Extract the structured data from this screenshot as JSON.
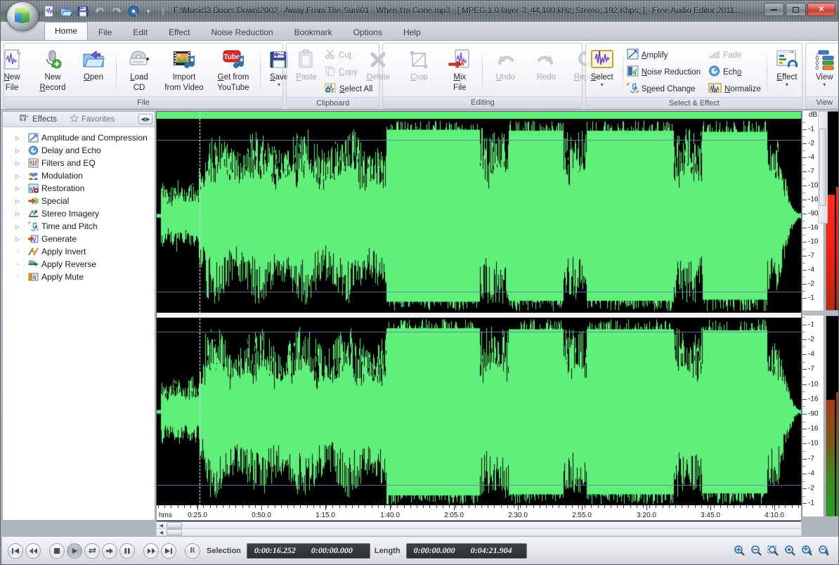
{
  "window": {
    "title": "F:\\Music\\3 Doors Down\\2002 - Away From The Sun\\01 - When I'm Gone.mp3 - [ MPEG 1.0 layer-3: 44,100 kHz; Stereo; 192 Kbps;  ] - Free Audio Editor 2011...",
    "minimize": "–",
    "maximize": "□",
    "close": "✕"
  },
  "quick_access": [
    {
      "name": "new-file",
      "icon": "new-file-icon"
    },
    {
      "name": "open",
      "icon": "open-folder-icon"
    },
    {
      "name": "save",
      "icon": "save-disk-icon"
    },
    {
      "name": "undo",
      "icon": "undo-icon"
    },
    {
      "name": "redo",
      "icon": "redo-icon"
    },
    {
      "name": "burn-cd",
      "icon": "burn-cd-icon"
    },
    {
      "name": "customize",
      "icon": "chevron-down-icon"
    }
  ],
  "tabs": [
    {
      "label": "Home",
      "active": true
    },
    {
      "label": "File",
      "active": false
    },
    {
      "label": "Edit",
      "active": false
    },
    {
      "label": "Effect",
      "active": false
    },
    {
      "label": "Noise Reduction",
      "active": false
    },
    {
      "label": "Bookmark",
      "active": false
    },
    {
      "label": "Options",
      "active": false
    },
    {
      "label": "Help",
      "active": false
    }
  ],
  "ribbon": {
    "file_group": {
      "title": "File",
      "buttons": [
        {
          "line1": "New",
          "line2": "File",
          "icon": "new-file-icon"
        },
        {
          "line1": "New",
          "line2": "Record",
          "icon": "microphone-record-icon"
        },
        {
          "line1": "Open",
          "line2": "",
          "icon": "open-folder-icon"
        },
        {
          "line1": "Load",
          "line2": "CD",
          "icon": "cd-drive-icon"
        },
        {
          "line1": "Import",
          "line2": "from Video",
          "icon": "film-music-icon"
        },
        {
          "line1": "Get from",
          "line2": "YouTube",
          "icon": "youtube-icon"
        },
        {
          "line1": "Save",
          "line2": "",
          "icon": "save-disk-icon",
          "dropdown": true
        }
      ]
    },
    "clipboard_group": {
      "title": "Clipboard",
      "paste": {
        "label": "Paste",
        "icon": "paste-icon",
        "disabled": true
      },
      "items": [
        {
          "label": "Cut",
          "icon": "scissors-icon",
          "disabled": true
        },
        {
          "label": "Copy",
          "icon": "copy-icon",
          "disabled": true
        },
        {
          "label": "Select All",
          "icon": "select-all-icon",
          "disabled": false
        }
      ]
    },
    "editing_group": {
      "title": "Editing",
      "buttons": [
        {
          "line1": "Delete",
          "line2": "",
          "icon": "delete-x-icon",
          "disabled": true
        },
        {
          "line1": "Crop",
          "line2": "",
          "icon": "crop-icon",
          "disabled": true
        },
        {
          "line1": "Mix",
          "line2": "File",
          "icon": "mix-file-icon",
          "disabled": false
        },
        {
          "line1": "Undo",
          "line2": "",
          "icon": "undo-icon",
          "disabled": true
        },
        {
          "line1": "Redo",
          "line2": "",
          "icon": "redo-icon",
          "disabled": true
        },
        {
          "line1": "Repeat",
          "line2": "",
          "icon": "repeat-icon",
          "disabled": true
        }
      ]
    },
    "select_effect_group": {
      "title": "Select & Effect",
      "select": {
        "label": "Select",
        "icon": "select-wave-icon",
        "dropdown": true
      },
      "items": [
        {
          "label": "Amplify",
          "icon": "amplify-icon",
          "disabled": false
        },
        {
          "label": "Fade",
          "icon": "fade-icon",
          "disabled": true
        },
        {
          "label": "Noise Reduction",
          "icon": "noise-reduction-icon",
          "disabled": false
        },
        {
          "label": "Echo",
          "icon": "echo-icon",
          "disabled": false
        },
        {
          "label": "Speed Change",
          "icon": "speed-change-icon",
          "disabled": false
        },
        {
          "label": "Normalize",
          "icon": "normalize-icon",
          "disabled": false
        }
      ],
      "effect": {
        "label": "Effect",
        "icon": "effect-window-icon",
        "dropdown": true
      }
    },
    "view_group": {
      "title": "View",
      "view": {
        "label": "View",
        "icon": "view-list-icon",
        "dropdown": true
      }
    }
  },
  "dock": {
    "tabs": [
      {
        "label": "Effects",
        "icon": "effects-icon",
        "active": true
      },
      {
        "label": "Favorites",
        "icon": "star-icon",
        "active": false
      }
    ],
    "nav": {
      "prev": "◀",
      "next": "▶"
    },
    "tree": [
      {
        "label": "Amplitude and Compression",
        "expandable": true,
        "icon": "amplitude-icon"
      },
      {
        "label": "Delay and Echo",
        "expandable": true,
        "icon": "delay-echo-icon"
      },
      {
        "label": "Filters and EQ",
        "expandable": true,
        "icon": "filters-eq-icon"
      },
      {
        "label": "Modulation",
        "expandable": true,
        "icon": "modulation-icon"
      },
      {
        "label": "Restoration",
        "expandable": true,
        "icon": "restoration-icon"
      },
      {
        "label": "Special",
        "expandable": true,
        "icon": "special-icon"
      },
      {
        "label": "Stereo Imagery",
        "expandable": true,
        "icon": "stereo-imagery-icon"
      },
      {
        "label": "Time and Pitch",
        "expandable": true,
        "icon": "time-pitch-icon"
      },
      {
        "label": "Generate",
        "expandable": true,
        "icon": "generate-icon"
      },
      {
        "label": "Apply Invert",
        "expandable": false,
        "icon": "apply-invert-icon"
      },
      {
        "label": "Apply Reverse",
        "expandable": false,
        "icon": "apply-reverse-icon"
      },
      {
        "label": "Apply Mute",
        "expandable": false,
        "icon": "apply-mute-icon"
      }
    ]
  },
  "waveform": {
    "db_header": "dB",
    "db_scale": [
      "-1",
      "-2",
      "-4",
      "-7",
      "-10",
      "-16",
      "-90",
      "-16",
      "-10",
      "-7",
      "-4",
      "-2",
      "-1"
    ],
    "wave_color": "#5ef07a",
    "background": "#000000",
    "cursor_color": "#ffffff",
    "guide_color": "#6f80a8",
    "cursor_position_ratio": 0.066,
    "channels": 2
  },
  "timeline": {
    "unit_label": "hms",
    "ticks": [
      "0:25.0",
      "0:50.0",
      "1:15.0",
      "1:40.0",
      "2:05.0",
      "2:30.0",
      "2:55.0",
      "3:20.0",
      "3:45.0",
      "4:10.0"
    ]
  },
  "transport": [
    {
      "name": "go-to-start-button",
      "glyph": "start"
    },
    {
      "name": "rewind-button",
      "glyph": "rew"
    },
    {
      "name": "stop-button",
      "glyph": "stop"
    },
    {
      "name": "play-button",
      "glyph": "play",
      "pressed": true
    },
    {
      "name": "loop-button",
      "glyph": "loop"
    },
    {
      "name": "play-to-end-button",
      "glyph": "playend"
    },
    {
      "name": "pause-button",
      "glyph": "pause"
    },
    {
      "name": "fast-forward-button",
      "glyph": "ff"
    },
    {
      "name": "go-to-end-button",
      "glyph": "end"
    },
    {
      "name": "record-button",
      "glyph": "R"
    }
  ],
  "status": {
    "selection_label": "Selection",
    "selection_start": "0:00:16.252",
    "selection_end": "0:00:00.000",
    "length_label": "Length",
    "length_start": "0:00:00.000",
    "length_end": "0:04:21.904"
  },
  "zoom_buttons": [
    {
      "name": "zoom-in-button",
      "icon": "magnifier-plus-icon"
    },
    {
      "name": "zoom-out-button",
      "icon": "magnifier-minus-icon"
    },
    {
      "name": "zoom-selection-button",
      "icon": "magnifier-selection-icon"
    },
    {
      "name": "zoom-full-button",
      "icon": "magnifier-full-icon"
    },
    {
      "name": "zoom-vertical-in-button",
      "icon": "magnifier-vplus-icon"
    },
    {
      "name": "zoom-vertical-out-button",
      "icon": "magnifier-vminus-icon"
    }
  ]
}
